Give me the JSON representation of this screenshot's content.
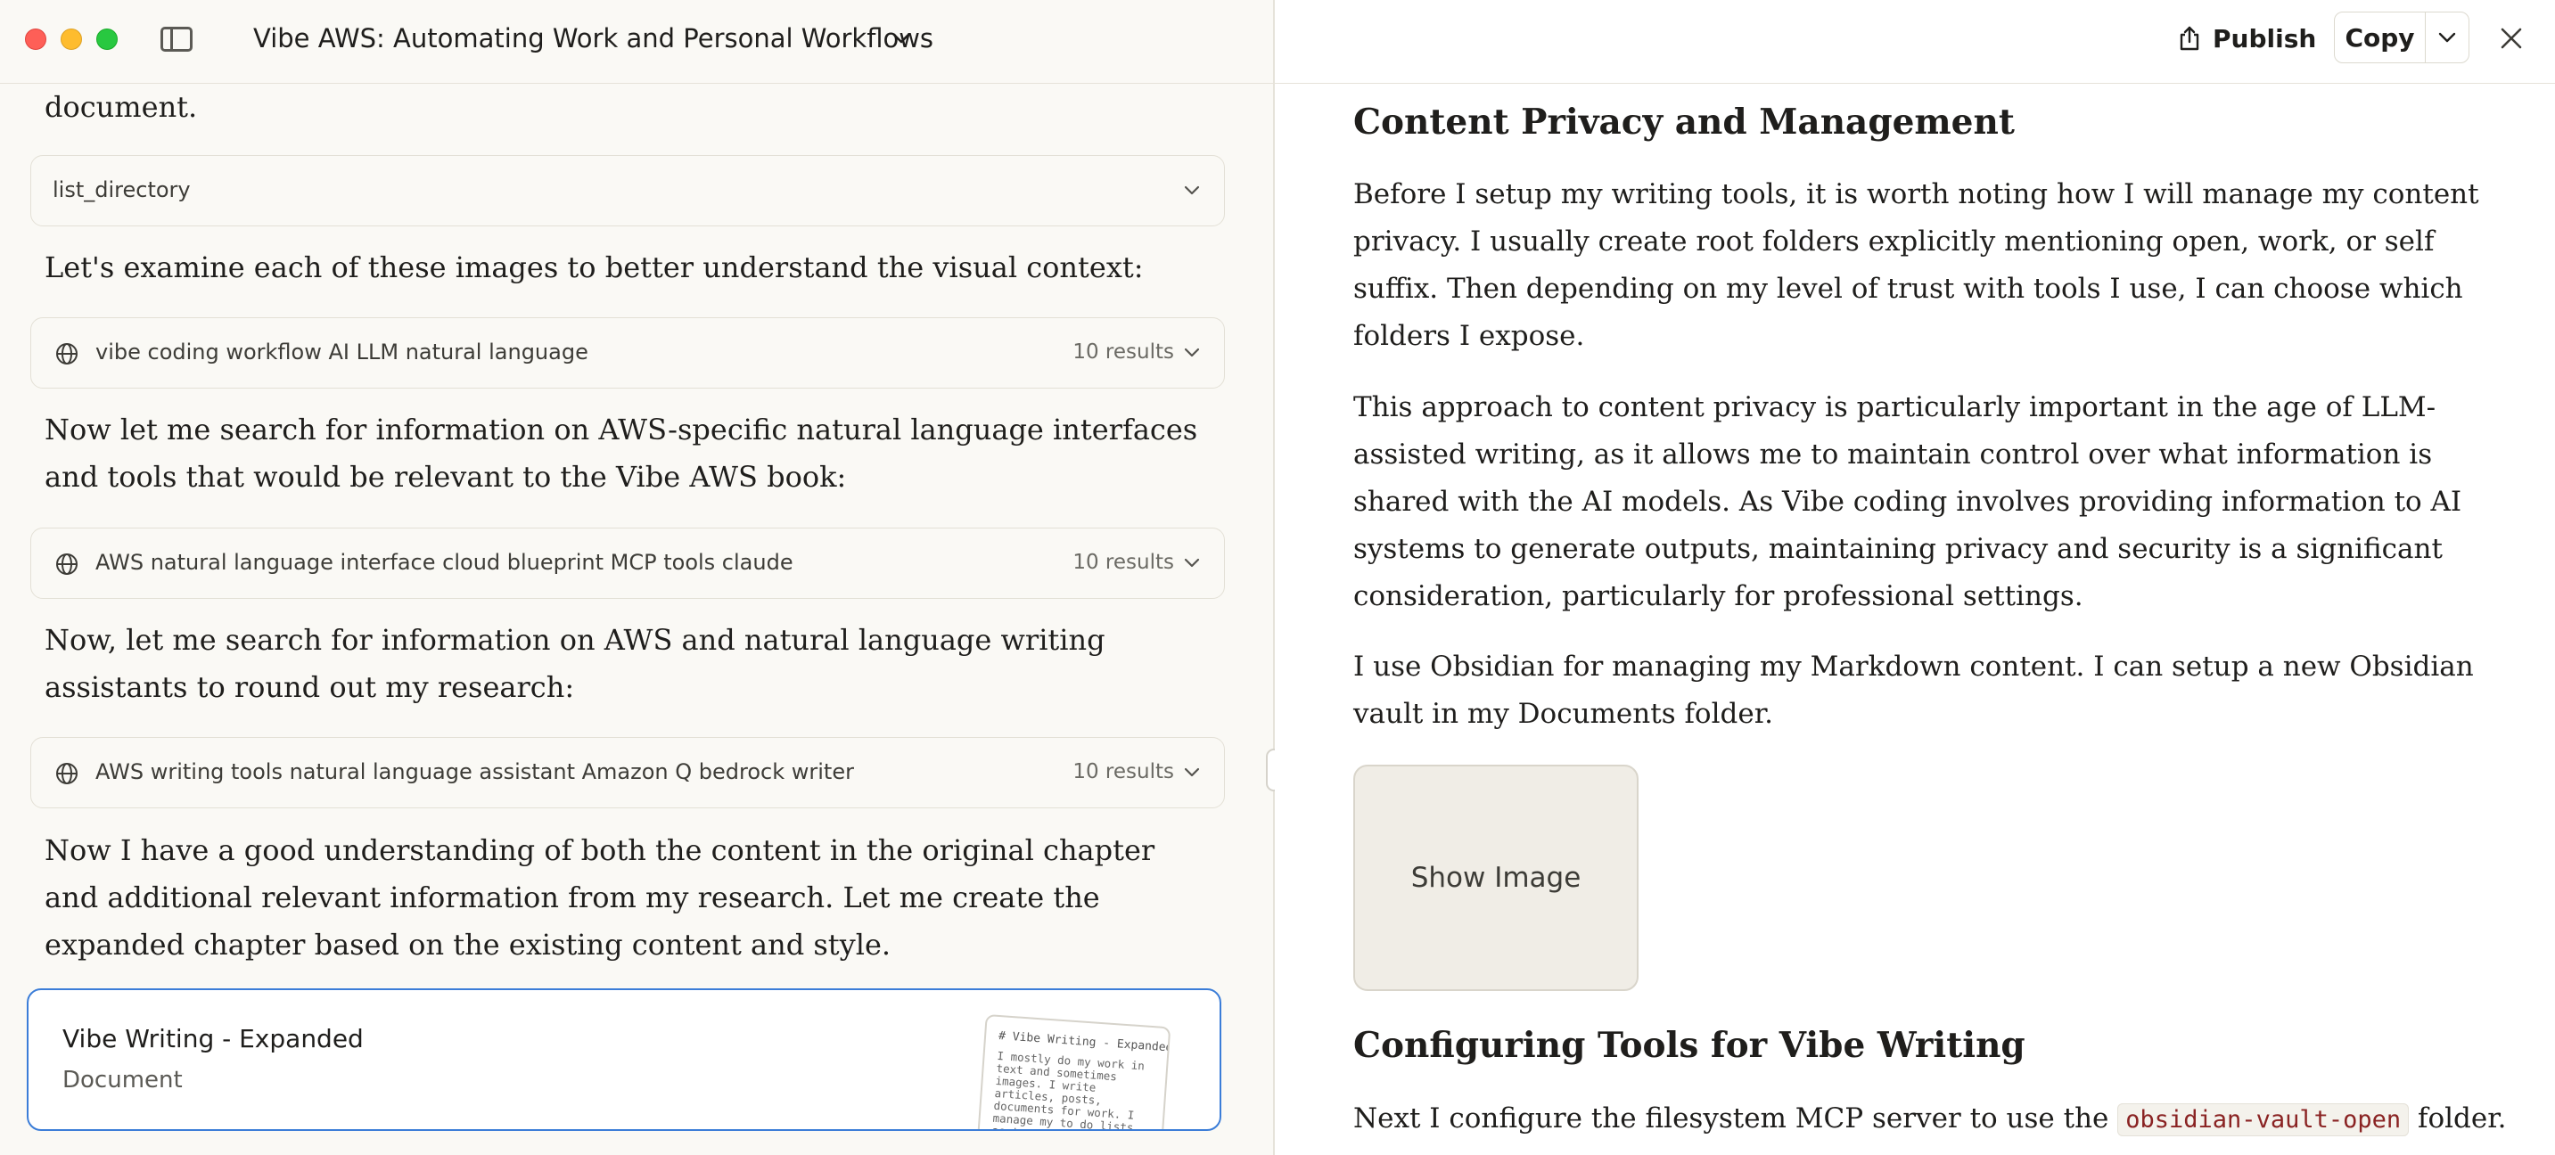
{
  "window": {
    "title": "Vibe AWS: Automating Work and Personal Workflows"
  },
  "chat": {
    "intro_fragment": "document.",
    "tool_list_directory": "list_directory",
    "p_examine": "Let's examine each of these images to better understand the visual context:",
    "search1": {
      "query": "vibe coding workflow AI LLM natural language",
      "results": "10 results"
    },
    "p_search_aws": "Now let me search for information on AWS-specific natural language interfaces and tools that would be relevant to the Vibe AWS book:",
    "search2": {
      "query": "AWS natural language interface cloud blueprint MCP tools claude",
      "results": "10 results"
    },
    "p_search_writing": "Now, let me search for information on AWS and natural language writing assistants to round out my research:",
    "search3": {
      "query": "AWS writing tools natural language assistant Amazon Q bedrock writer",
      "results": "10 results"
    },
    "p_understanding": "Now I have a good understanding of both the content in the original chapter and additional relevant information from my research. Let me create the expanded chapter based on the existing content and style.",
    "artifact": {
      "title": "Vibe Writing - Expanded",
      "type": "Document",
      "thumb_title": "# Vibe Writing - Expanded",
      "thumb_body": "I mostly do my work in text and sometimes images. I write articles, posts, documents for work. I manage my to do lists as text outlines. I capture my meeting notes as text. And so on. Vibe Wr"
    }
  },
  "artifact_panel": {
    "publish_label": "Publish",
    "copy_label": "Copy",
    "heading_privacy": "Content Privacy and Management",
    "p1": "Before I setup my writing tools, it is worth noting how I will manage my content privacy. I usually create root folders explicitly mentioning open, work, or self suffix. Then depending on my level of trust with tools I use, I can choose which folders I expose.",
    "p2": "This approach to content privacy is particularly important in the age of LLM-assisted writing, as it allows me to maintain control over what information is shared with the AI models. As Vibe coding involves providing information to AI systems to generate outputs, maintaining privacy and security is a significant consideration, particularly for professional settings.",
    "p3": "I use Obsidian for managing my Markdown content. I can setup a new Obsidian vault in my Documents folder.",
    "show_image_label": "Show Image",
    "heading_tools": "Configuring Tools for Vibe Writing",
    "p4_before": "Next I configure the filesystem MCP server to use the ",
    "p4_code": "obsidian-vault-open",
    "p4_after": " folder."
  },
  "icons": {
    "traffic_lights": [
      "close-window",
      "minimize-window",
      "zoom-window"
    ],
    "sidebar": "sidebar-toggle-icon",
    "search": "globe-icon",
    "publish": "share-icon",
    "close": "close-icon"
  },
  "colors": {
    "accent_blue": "#3b7dd8",
    "code_text": "#8a2323",
    "left_bg": "#faf9f5",
    "right_bg": "#ffffff"
  }
}
